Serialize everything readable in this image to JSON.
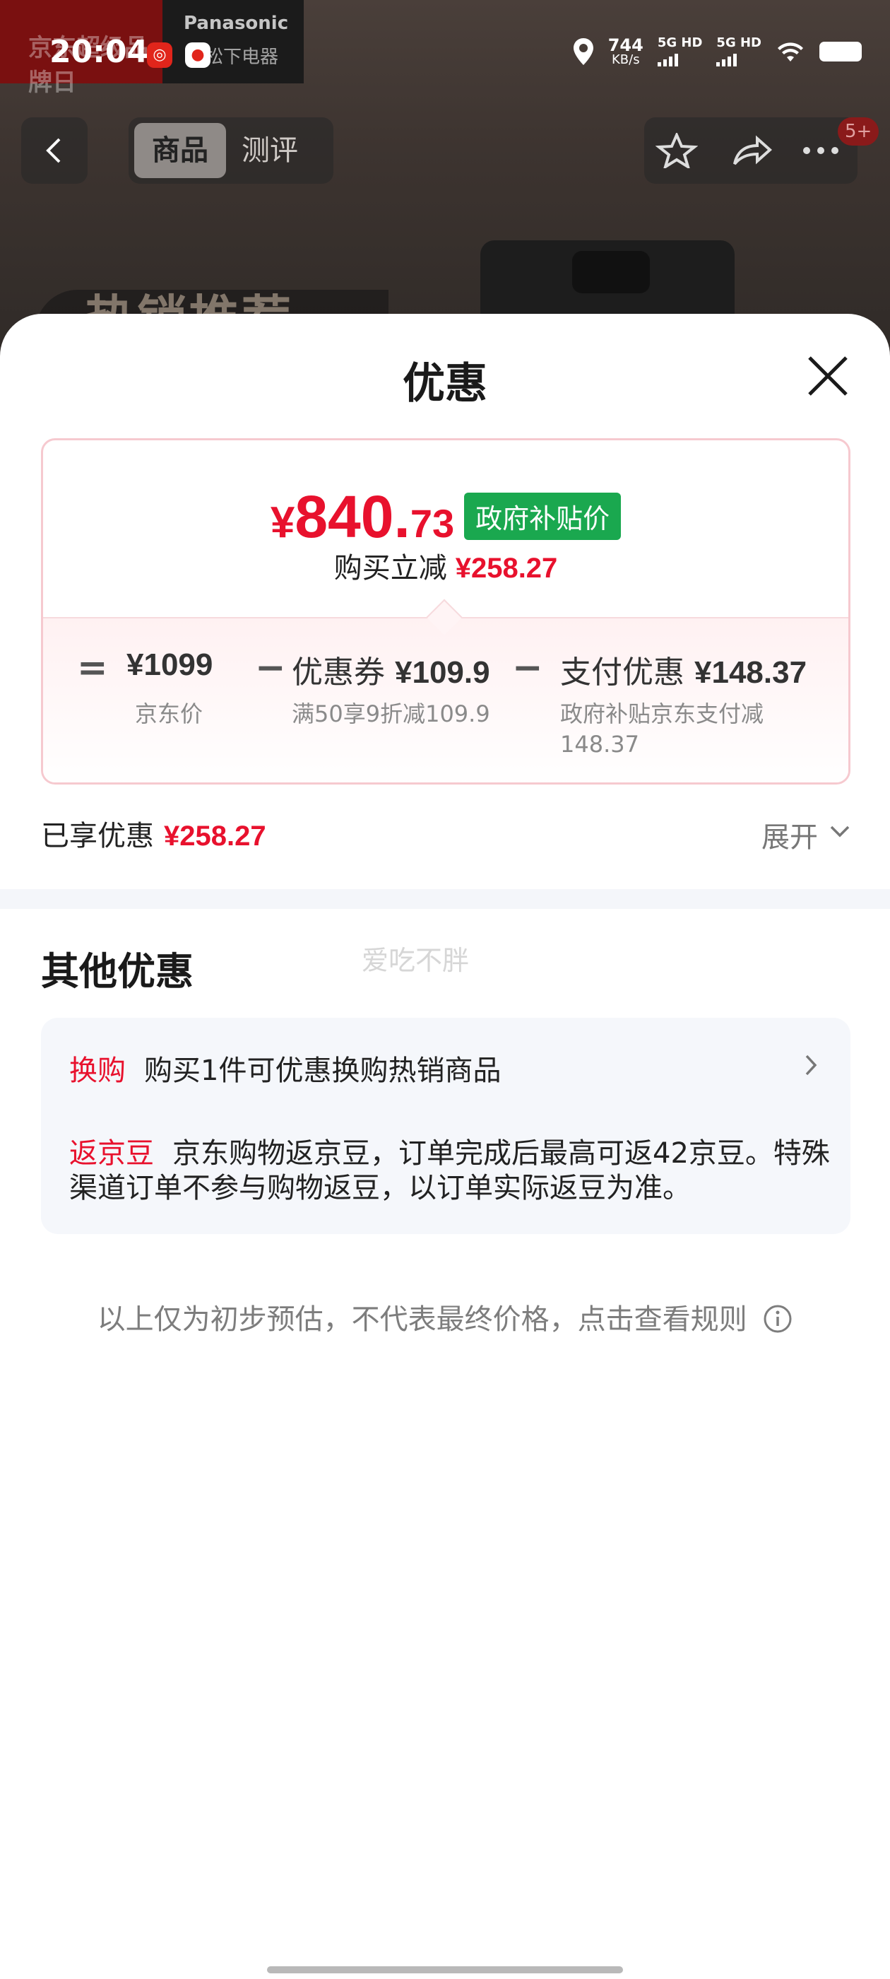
{
  "status_bar": {
    "time": "20:04",
    "brand_left": "京东超级品牌日",
    "brand_right_line1": "Panasonic",
    "brand_right_line2": "松下电器",
    "net_speed_value": "744",
    "net_speed_unit": "KB/s",
    "network1": "5G HD",
    "network2": "5G HD"
  },
  "nav": {
    "tab_active": "商品",
    "tab_other": "测评",
    "badge": "5+",
    "background_banner": "热销推荐"
  },
  "sheet": {
    "title": "优惠"
  },
  "price_card": {
    "currency": "¥",
    "price_int": "840.",
    "price_dec": "73",
    "gov_tag": "政府补贴价",
    "reduce_label": "购买立减",
    "reduce_amount": "¥258.27",
    "eq": "=",
    "minus": "−",
    "item1_value": "¥1099",
    "item1_desc": "京东价",
    "item2_label": "优惠券",
    "item2_value": "¥109.9",
    "item2_desc": "满50享9折减109.9",
    "item3_label": "支付优惠",
    "item3_value": "¥148.37",
    "item3_desc": "政府补贴京东支付减148.37"
  },
  "enjoyed": {
    "label": "已享优惠",
    "amount": "¥258.27",
    "expand_label": "展开"
  },
  "other": {
    "title": "其他优惠",
    "watermark": "爱吃不胖",
    "swap_tag": "换购",
    "swap_text": "购买1件可优惠换购热销商品",
    "bean_tag": "返京豆",
    "bean_text": "京东购物返京豆，订单完成后最高可返42京豆。特殊渠道订单不参与购物返豆，以订单实际返豆为准。"
  },
  "footnote": "以上仅为初步预估，不代表最终价格，点击查看规则",
  "colors": {
    "accent_red": "#e8112d",
    "gov_green": "#1aa84f",
    "card_border": "#f6c9cf"
  }
}
